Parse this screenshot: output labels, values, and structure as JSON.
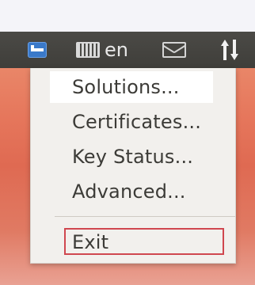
{
  "panel": {
    "language": "en",
    "icons": {
      "app_indicator": "key-icon",
      "keyboard": "keyboard-icon",
      "mail": "envelope-icon",
      "network": "up-down-arrows-icon"
    }
  },
  "menu": {
    "items": [
      {
        "label": "Solutions..."
      },
      {
        "label": "Certificates..."
      },
      {
        "label": "Key Status..."
      },
      {
        "label": "Advanced..."
      }
    ],
    "exit_label": "Exit"
  },
  "colors": {
    "panel_bg": "#3f3e3a",
    "menu_bg": "#f2f0ed",
    "highlight_outline": "#d0474f",
    "desktop_orange": "#e07a63"
  }
}
